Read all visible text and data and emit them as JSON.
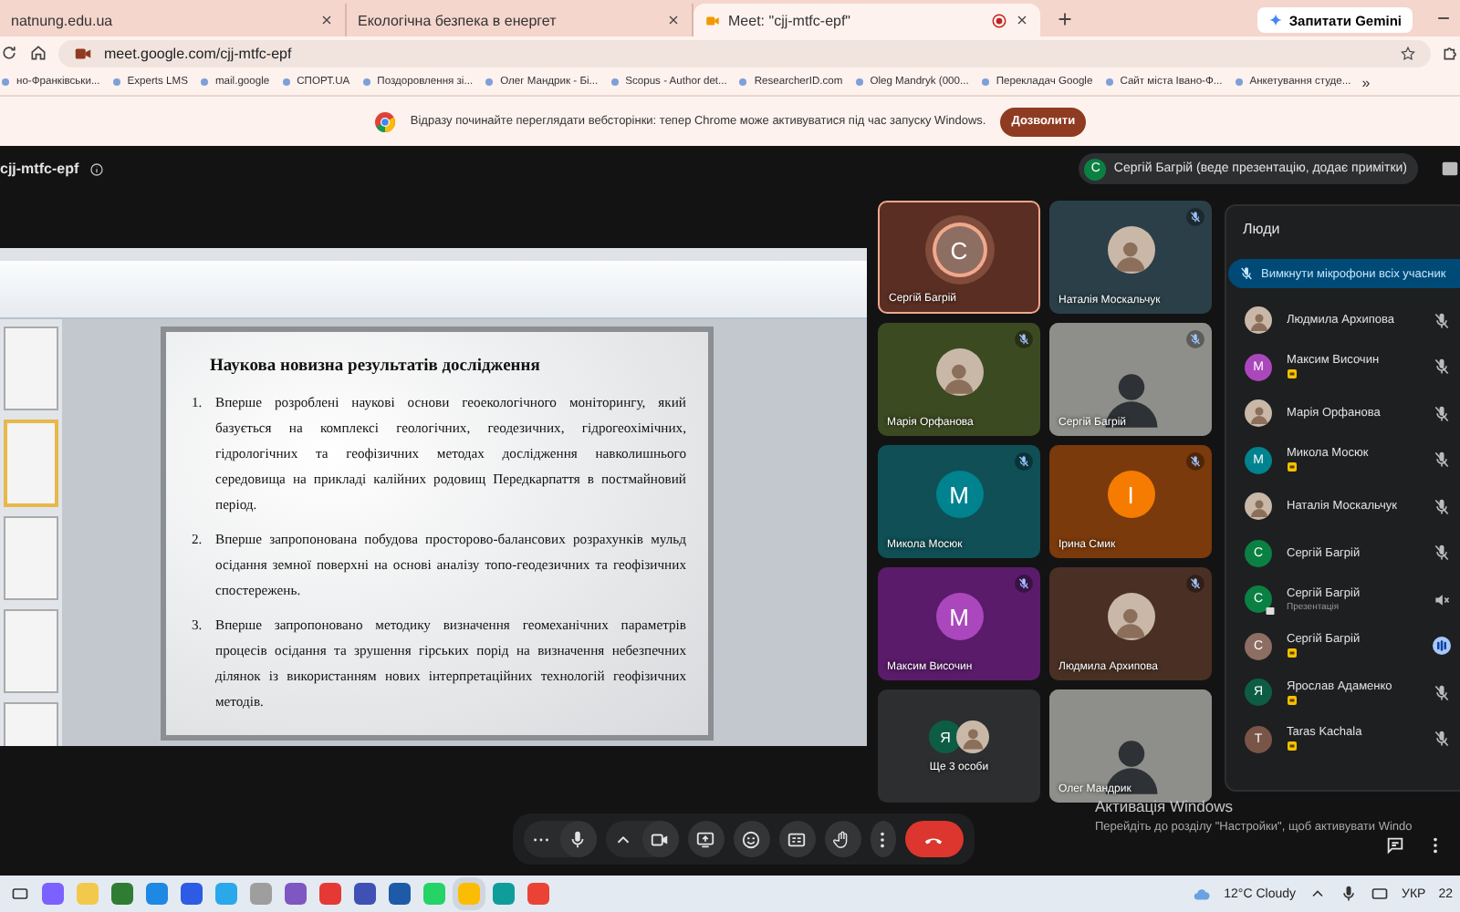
{
  "browser": {
    "tabs": [
      {
        "title": "natnung.edu.ua",
        "selected": false,
        "recording": false
      },
      {
        "title": "Екологічна безпека в енергет",
        "selected": false,
        "recording": false
      },
      {
        "title": "Meet: \"cjj-mtfc-epf\"",
        "selected": true,
        "recording": true
      }
    ],
    "gemini_button": "Запитати Gemini",
    "url": "meet.google.com/cjj-mtfc-epf",
    "bookmarks": [
      "но-Франківськи...",
      "Experts LMS",
      "mail.google",
      "СПОРТ.UA",
      "Поздоровлення зі...",
      "Олег Мандрик - Бі...",
      "Scopus - Author det...",
      "ResearcherID.com",
      "Oleg Mandryk (000...",
      "Перекладач Google",
      "Сайт міста Івано-Ф...",
      "Анкетування студе..."
    ],
    "bookmarks_more": "»",
    "infobar": {
      "message": "Відразу починайте переглядати вебсторінки: тепер Chrome може активуватися під час запуску Windows.",
      "button": "Дозволити"
    }
  },
  "meet": {
    "meeting_code": "cjj-mtfc-epf",
    "presenter_chip": {
      "letter": "С",
      "label": "Сергій Багрій (веде презентацію, додає примітки)"
    },
    "slide": {
      "title": "Наукова новизна результатів дослідження",
      "items": [
        {
          "number": "1.",
          "text": "Вперше розроблені наукові основи геоекологічного моніторингу, який базується на комплексі геологічних, геодезичних, гідрогеохімічних, гідрологічних та геофізичних методах дослідження навколишнього середовища на прикладі калійних родовищ Передкарпаття в постмайновий період."
        },
        {
          "number": "2.",
          "text": "Вперше запропонована побудова просторово-балансових розрахунків мульд осідання земної поверхні на основі аналізу топо-геодезичних та геофізичних спостережень."
        },
        {
          "number": "3.",
          "text": "Вперше запропоновано методику визначення геомеханічних параметрів процесів осідання та зрушення гірських порід на визначення небезпечних ділянок із використанням нових інтерпретаційних технологій геофізичних методів."
        }
      ]
    },
    "tiles": [
      {
        "name": "Сергій Багрій",
        "kind": "letter",
        "avatar": {
          "letter": "С",
          "color": "#8d6e63"
        },
        "color": "#5a2e22",
        "muted": false,
        "active": true
      },
      {
        "name": "Наталія Москальчук",
        "kind": "photo",
        "color": "#2b3f48",
        "muted": true,
        "active": false
      },
      {
        "name": "Марія Орфанова",
        "kind": "photo",
        "color": "#3c4a22",
        "muted": true,
        "active": false
      },
      {
        "name": "Сергій Багрій",
        "kind": "video",
        "color": "#6b6b66",
        "muted": true,
        "active": false
      },
      {
        "name": "Микола Мосюк",
        "kind": "letter",
        "avatar": {
          "letter": "M",
          "color": "#00838f"
        },
        "color": "#0f4f55",
        "muted": true,
        "active": false
      },
      {
        "name": "Ірина Смик",
        "kind": "letter",
        "avatar": {
          "letter": "I",
          "color": "#f57c00"
        },
        "color": "#7a3a0c",
        "muted": true,
        "active": false
      },
      {
        "name": "Максим Височин",
        "kind": "letter",
        "avatar": {
          "letter": "M",
          "color": "#ab47bc"
        },
        "color": "#5a1b6a",
        "muted": true,
        "active": false
      },
      {
        "name": "Людмила Архипова",
        "kind": "photo",
        "color": "#4a3024",
        "muted": true,
        "active": false
      },
      {
        "name": "Ще 3 особи",
        "kind": "more",
        "avatar": {
          "letter": "Я",
          "color": "#0d5d45"
        },
        "color": "#2d2e30",
        "muted": false,
        "active": false
      },
      {
        "name": "Олег Мандрик",
        "kind": "video",
        "color": "#7d7f7c",
        "muted": false,
        "active": false
      }
    ],
    "people": {
      "title": "Люди",
      "mute_all": "Вимкнути мікрофони всіх учасник",
      "list": [
        {
          "name": "Людмила Архипова",
          "kind": "photo",
          "host": false,
          "presenting": false,
          "muted": true,
          "audio_off": false,
          "speaking": false
        },
        {
          "name": "Максим Височин",
          "kind": "letter",
          "letter": "M",
          "color": "#ab47bc",
          "host": true,
          "presenting": false,
          "muted": true,
          "audio_off": false,
          "speaking": false
        },
        {
          "name": "Марія Орфанова",
          "kind": "photo",
          "host": false,
          "presenting": false,
          "muted": true,
          "audio_off": false,
          "speaking": false
        },
        {
          "name": "Микола Мосюк",
          "kind": "letter",
          "letter": "M",
          "color": "#00838f",
          "host": true,
          "presenting": false,
          "muted": true,
          "audio_off": false,
          "speaking": false
        },
        {
          "name": "Наталія Москальчук",
          "kind": "photo",
          "host": false,
          "presenting": false,
          "muted": true,
          "audio_off": false,
          "speaking": false
        },
        {
          "name": "Сергій Багрій",
          "kind": "letter",
          "letter": "С",
          "color": "#0b8043",
          "host": false,
          "presenting": false,
          "muted": true,
          "audio_off": false,
          "speaking": false
        },
        {
          "name": "Сергій Багрій",
          "subtitle": "Презентація",
          "kind": "letter",
          "letter": "С",
          "color": "#0b8043",
          "host": false,
          "presenting": true,
          "muted": false,
          "audio_off": true,
          "speaking": false
        },
        {
          "name": "Сергій Багрій",
          "kind": "letter",
          "letter": "С",
          "color": "#8d6e63",
          "host": true,
          "presenting": false,
          "muted": false,
          "audio_off": false,
          "speaking": true
        },
        {
          "name": "Ярослав Адаменко",
          "kind": "letter",
          "letter": "Я",
          "color": "#0d5d45",
          "host": true,
          "presenting": false,
          "muted": true,
          "audio_off": false,
          "speaking": false
        },
        {
          "name": "Taras Kachala",
          "kind": "letter",
          "letter": "T",
          "color": "#795548",
          "host": true,
          "presenting": false,
          "muted": true,
          "audio_off": false,
          "speaking": false
        }
      ]
    }
  },
  "os_notice": {
    "title": "Активація Windows",
    "text": "Перейдіть до розділу \"Настройки\", щоб активувати Windo"
  },
  "taskbar": {
    "apps": [
      {
        "color": "#7b61ff",
        "selected": false
      },
      {
        "color": "#f2c94c",
        "selected": false
      },
      {
        "color": "#2e7d32",
        "selected": false
      },
      {
        "color": "#1e88e5",
        "selected": false
      },
      {
        "color": "#2d5be3",
        "selected": false
      },
      {
        "color": "#29a9ea",
        "selected": false
      },
      {
        "color": "#9e9e9e",
        "selected": false
      },
      {
        "color": "#7e57c2",
        "selected": false
      },
      {
        "color": "#e53935",
        "selected": false
      },
      {
        "color": "#3f51b5",
        "selected": false
      },
      {
        "color": "#1e5aa8",
        "selected": false
      },
      {
        "color": "#25d366",
        "selected": false
      },
      {
        "color": "#fbbc04",
        "selected": true
      },
      {
        "color": "#0f9d9a",
        "selected": false
      },
      {
        "color": "#ea4335",
        "selected": false
      }
    ],
    "weather": "12°C  Cloudy",
    "language": "УКР",
    "clock": "22"
  }
}
